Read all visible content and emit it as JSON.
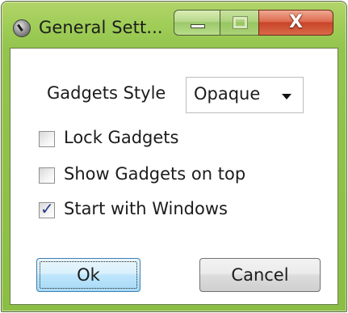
{
  "window": {
    "title": "General Sett...",
    "close_glyph": "X"
  },
  "form": {
    "gadgets_style_label": "Gadgets Style",
    "gadgets_style_value": "Opaque",
    "checkboxes": [
      {
        "label": "Lock Gadgets",
        "checked": false
      },
      {
        "label": "Show Gadgets on top",
        "checked": false
      },
      {
        "label": "Start with Windows",
        "checked": true
      }
    ],
    "check_mark": "✓"
  },
  "buttons": {
    "ok": "Ok",
    "cancel": "Cancel"
  }
}
